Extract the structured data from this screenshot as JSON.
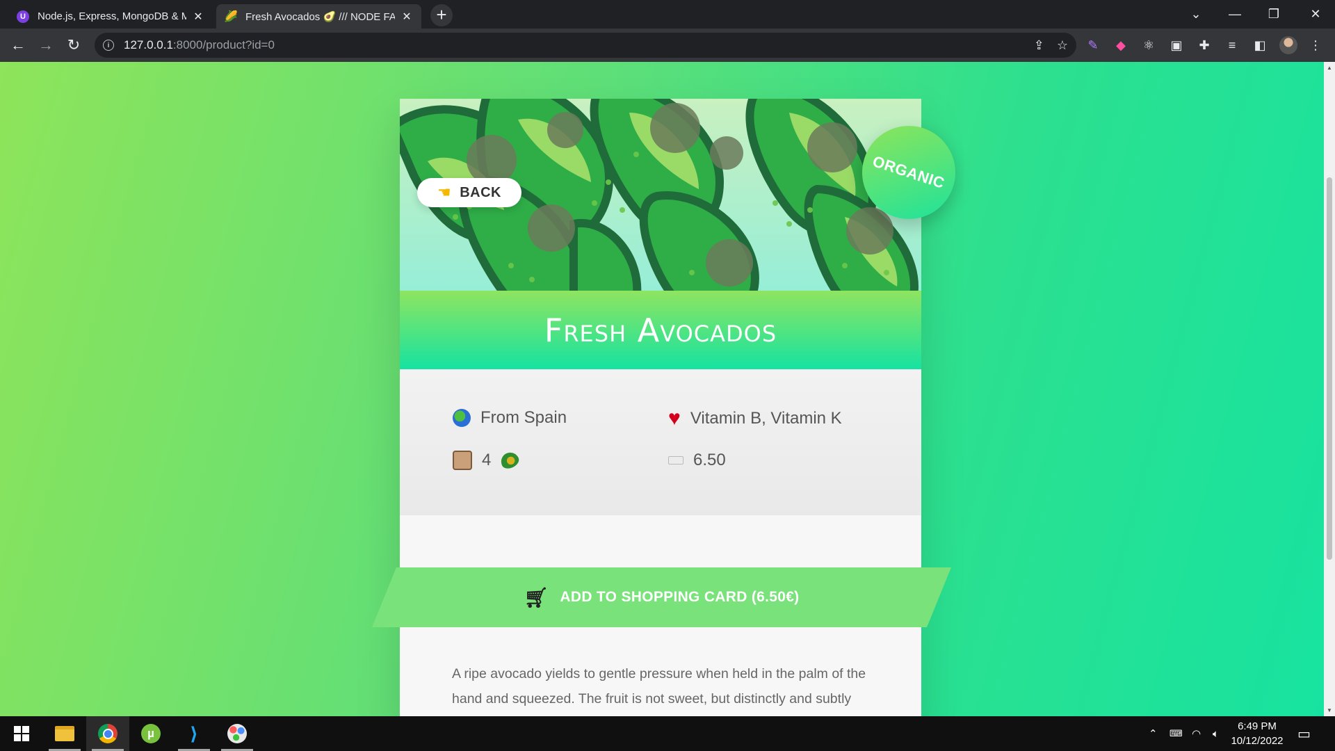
{
  "browser": {
    "tabs": [
      {
        "title": "Node.js, Express, MongoDB & M",
        "active": false
      },
      {
        "title": "Fresh Avocados 🥑 /// NODE FA",
        "active": true
      }
    ],
    "url_host": "127.0.0.1",
    "url_path": ":8000/product?id=0"
  },
  "product": {
    "back_label": "BACK",
    "organic_label": "ORGANIC",
    "name": "Fresh Avocados",
    "origin": "From Spain",
    "nutrients": "Vitamin B, Vitamin K",
    "quantity": "4",
    "price": "6.50",
    "cart_label": "ADD TO SHOPPING CARD (6.50€)",
    "description": "A ripe avocado yields to gentle pressure when held in the palm of the hand and squeezed. The fruit is not sweet, but distinctly and subtly flavored, with smooth texture. The avocado is popular in vegetarian cuisine as a substitute for meats in sandwiches and salads because of its high fat content. Generally, avocado is served"
  },
  "taskbar": {
    "time": "6:49 PM",
    "date": "10/12/2022"
  },
  "colors": {
    "accent_green": "#79e27a",
    "gradient_start": "#8ee45a",
    "gradient_end": "#17e3a0"
  }
}
